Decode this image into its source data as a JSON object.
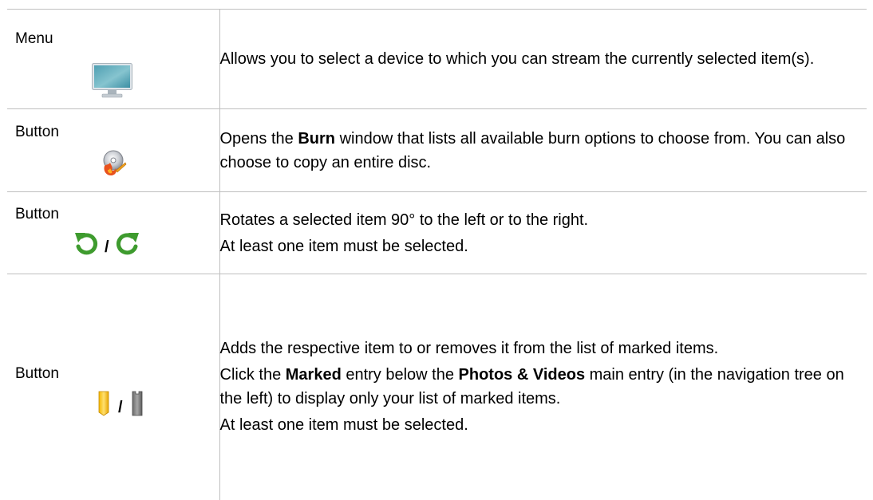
{
  "rows": [
    {
      "type": "Menu",
      "icons": [
        "monitor-icon"
      ],
      "paragraphs": [
        {
          "segments": [
            {
              "text": "Allows you to select a device to which you can stream the currently selected item(s).",
              "bold": false
            }
          ]
        }
      ]
    },
    {
      "type": "Button",
      "icons": [
        "burn-disc-icon"
      ],
      "paragraphs": [
        {
          "segments": [
            {
              "text": "Opens the ",
              "bold": false
            },
            {
              "text": "Burn",
              "bold": true
            },
            {
              "text": " window that lists all available burn options to choose from. You can also choose to copy an entire disc.",
              "bold": false
            }
          ]
        }
      ]
    },
    {
      "type": "Button",
      "icons": [
        "rotate-left-icon",
        "rotate-right-icon"
      ],
      "separator": "/",
      "paragraphs": [
        {
          "segments": [
            {
              "text": "Rotates a selected item 90° to the left or to the right.",
              "bold": false
            }
          ]
        },
        {
          "segments": [
            {
              "text": "At least one item must be selected.",
              "bold": false
            }
          ]
        }
      ]
    },
    {
      "type": "Button",
      "icons": [
        "mark-item-icon",
        "unmark-item-icon"
      ],
      "separator": "/",
      "paragraphs": [
        {
          "segments": [
            {
              "text": "Adds the respective item to or removes it from the list of marked items.",
              "bold": false
            }
          ]
        },
        {
          "segments": [
            {
              "text": "Click the ",
              "bold": false
            },
            {
              "text": "Marked",
              "bold": true
            },
            {
              "text": " entry below the ",
              "bold": false
            },
            {
              "text": "Photos & Videos",
              "bold": true
            },
            {
              "text": " main entry (in the navigation tree on the left) to display only your list of marked items.",
              "bold": false
            }
          ]
        },
        {
          "segments": [
            {
              "text": "At least one item must be selected.",
              "bold": false
            }
          ]
        }
      ]
    }
  ]
}
